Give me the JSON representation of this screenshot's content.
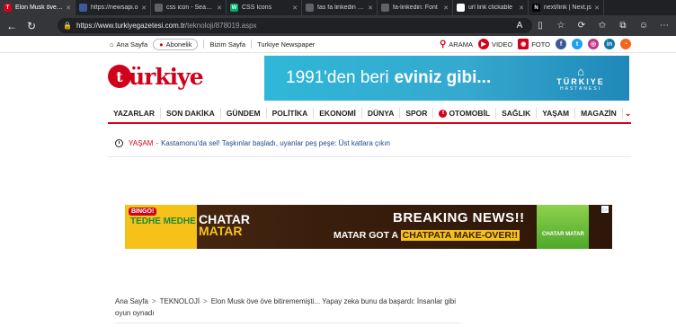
{
  "browser": {
    "tabs": [
      {
        "label": "Elon Musk öve öv",
        "fav_color": "#d0021b",
        "fav_glyph": "T",
        "active": true
      },
      {
        "label": "https://newsapi.o",
        "fav_color": "#3c5a99",
        "fav_glyph": "",
        "active": false
      },
      {
        "label": "css icon - Search",
        "fav_color": "#5f6368",
        "fav_glyph": "",
        "active": false
      },
      {
        "label": "CSS Icons",
        "fav_color": "#04aa6d",
        "fav_glyph": "W",
        "active": false
      },
      {
        "label": "fas fa linkedin - S",
        "fav_color": "#5f6368",
        "fav_glyph": "",
        "active": false
      },
      {
        "label": "fa-linkedin: Font",
        "fav_color": "#5f6368",
        "fav_glyph": "",
        "active": false
      },
      {
        "label": "url link clickable",
        "fav_color": "#ffffff",
        "fav_glyph": "",
        "active": false
      },
      {
        "label": "next/link | Next.js",
        "fav_color": "#000000",
        "fav_glyph": "N",
        "active": false
      }
    ],
    "url_host": "https://www.turkiyegazetesi.com.tr",
    "url_path": "/teknoloji/878019.aspx"
  },
  "site": {
    "top": {
      "home": "Ana Sayfa",
      "abonelik": "Abonelik",
      "bizim_sayfa": "Bizim Sayfa",
      "newspaper": "Turkiye Newspaper",
      "arama": "ARAMA",
      "video": "VIDEO",
      "foto": "FOTO"
    },
    "logo_text": "ürkiye",
    "logo_mark": "t",
    "banner": {
      "text_light": "1991'den beri",
      "text_bold": "eviniz gibi...",
      "brand": "TÜRKIYE",
      "brand_sub": "HASTANESI"
    },
    "nav": [
      "YAZARLAR",
      "SON DAKİKA",
      "GÜNDEM",
      "POLİTİKA",
      "EKONOMİ",
      "DÜNYA",
      "SPOR",
      "OTOMOBİL",
      "SAĞLIK",
      "YAŞAM",
      "MAGAZİN"
    ],
    "breaking": {
      "category": "YAŞAM",
      "headline": "Kastamonu'da sel! Taşkınlar başladı, uyanlar peş peşe: Üst katlara çıkın"
    },
    "ad": {
      "brand": "BINGO!",
      "tedhe": "TEDHE MEDHE",
      "product_line1": "CHATAR",
      "product_line2": "MATAR",
      "headline": "BREAKING NEWS!!",
      "sub_a": "MATAR GOT A",
      "sub_b": "CHATPATA MAKE-OVER!!",
      "pack_text": "CHATAR MATAR"
    },
    "breadcrumb": {
      "home": "Ana Sayfa",
      "section": "TEKNOLOJİ",
      "title": "Elon Musk öve öve bitirememişti... Yapay zeka bunu da başardı: İnsanlar gibi oyun oynadı"
    }
  },
  "colors": {
    "brand_red": "#d0021b",
    "link_blue": "#1a4a8a",
    "banner_cyan": "#2fb7d8"
  }
}
